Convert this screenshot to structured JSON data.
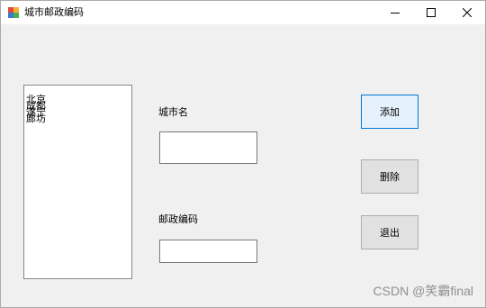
{
  "window": {
    "title": "城市邮政编码"
  },
  "caption_buttons": {
    "minimize": "minimize-icon",
    "maximize": "maximize-icon",
    "close": "close-icon"
  },
  "city_list": {
    "items": [
      "北京",
      "成都",
      "遂宁",
      "廊坊"
    ]
  },
  "form": {
    "city_label": "城市名",
    "city_value": "",
    "postcode_label": "邮政编码",
    "postcode_value": ""
  },
  "buttons": {
    "add": "添加",
    "delete": "删除",
    "exit": "退出"
  },
  "watermark": "CSDN @笑霸final",
  "colors": {
    "window_bg": "#f0f0f0",
    "default_button_border": "#0078d7",
    "default_button_bg": "#e5f1fb"
  }
}
